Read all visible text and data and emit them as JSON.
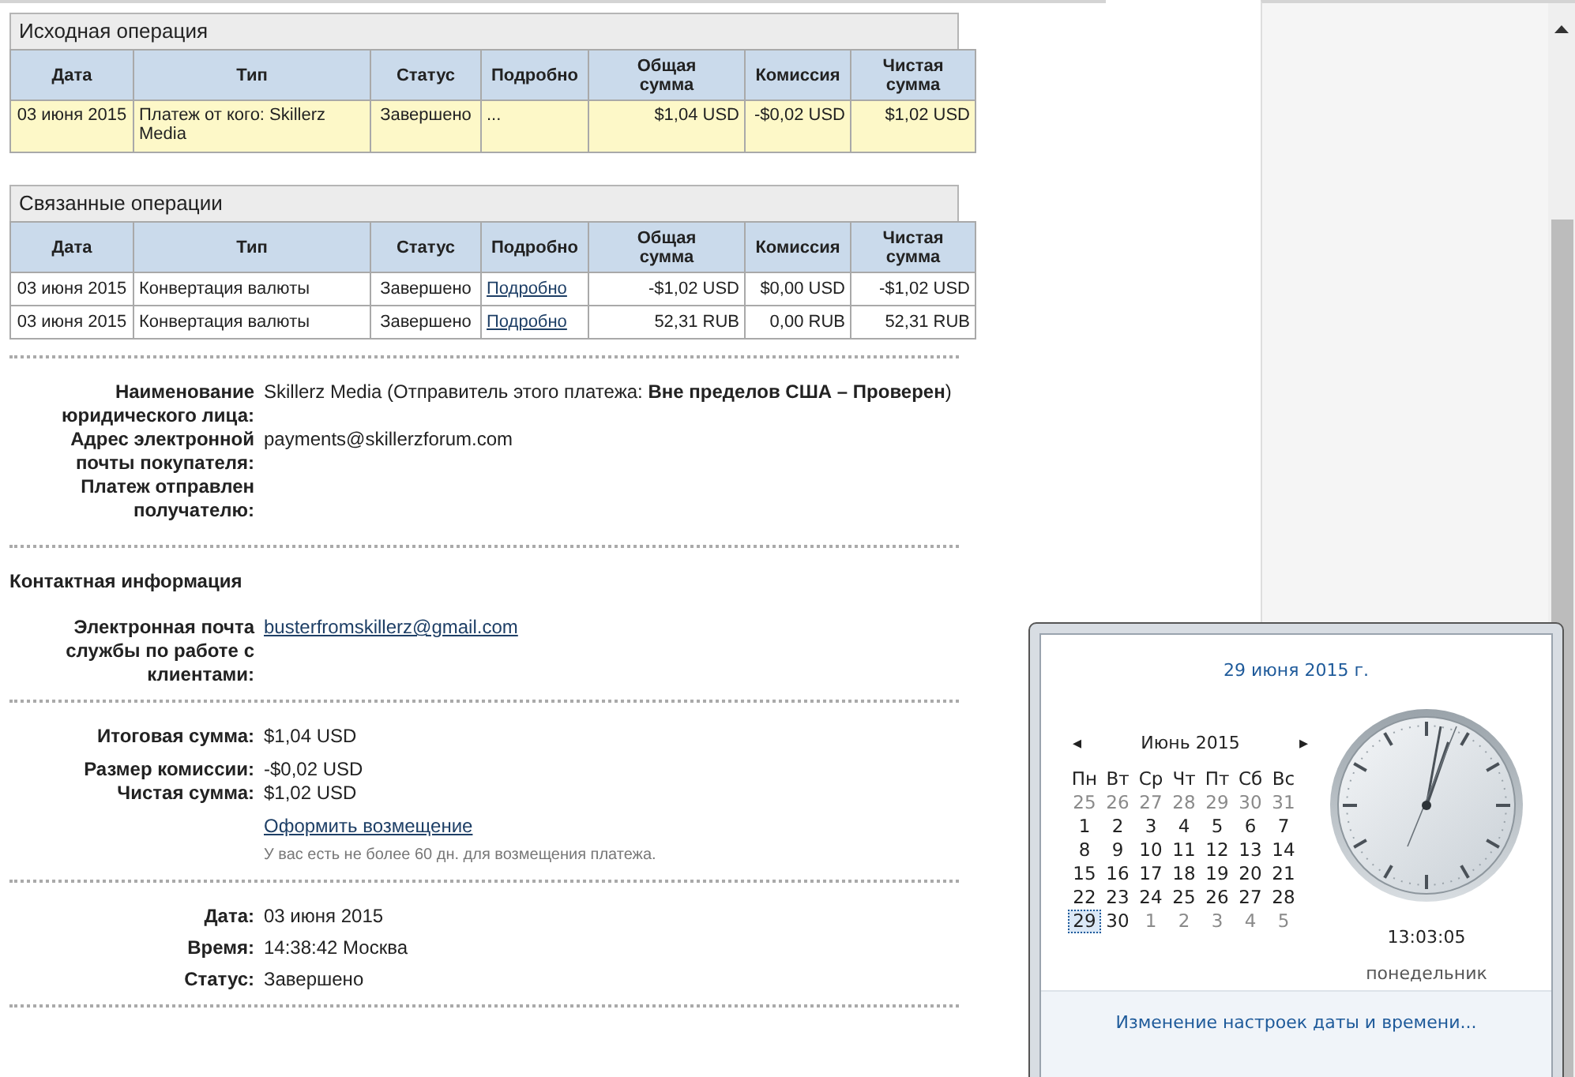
{
  "original_operation": {
    "title": "Исходная операция",
    "columns": [
      "Дата",
      "Тип",
      "Статус",
      "Подробно",
      "Общая сумма",
      "Комиссия",
      "Чистая сумма"
    ],
    "rows": [
      {
        "date": "03 июня 2015",
        "type": "Платеж от кого: Skillerz Media",
        "status": "Завершено",
        "details": {
          "kind": "text",
          "text": "..."
        },
        "gross": "$1,04 USD",
        "fee": "-$0,02 USD",
        "net": "$1,02 USD",
        "highlighted": true
      }
    ]
  },
  "related_operations": {
    "title": "Связанные операции",
    "columns": [
      "Дата",
      "Тип",
      "Статус",
      "Подробно",
      "Общая сумма",
      "Комиссия",
      "Чистая сумма"
    ],
    "rows": [
      {
        "date": "03 июня 2015",
        "type": "Конвертация валюты",
        "status": "Завершено",
        "details": {
          "kind": "link",
          "text": "Подробно"
        },
        "gross": "-$1,02 USD",
        "fee": "$0,00 USD",
        "net": "-$1,02 USD",
        "highlighted": false
      },
      {
        "date": "03 июня 2015",
        "type": "Конвертация валюты",
        "status": "Завершено",
        "details": {
          "kind": "link",
          "text": "Подробно"
        },
        "gross": "52,31 RUB",
        "fee": "0,00 RUB",
        "net": "52,31 RUB",
        "highlighted": false
      }
    ]
  },
  "payer": [
    {
      "label": "Наименование юридического лица:",
      "value": "Skillerz Media (Отправитель этого платежа: **Вне пределов США – Проверен**)"
    },
    {
      "label": "Адрес электронной почты покупателя:",
      "value": "payments@skillerzforum.com"
    },
    {
      "label": "Платеж отправлен получателю:"
    }
  ],
  "contact": {
    "title": "Контактная информация",
    "fields": [
      {
        "label": "Электронная почта службы по работе с клиентами:",
        "value": "busterfromskillerz@gmail.com",
        "kind": "link"
      }
    ]
  },
  "amounts": {
    "fields": [
      {
        "label": "Итоговая сумма:",
        "value": "$1,04 USD"
      },
      {
        "label": "Размер комиссии:",
        "value": "-$0,02 USD"
      },
      {
        "label": "Чистая сумма:",
        "value": "$1,02 USD"
      }
    ],
    "refund_link": "Оформить возмещение",
    "refund_note": "У вас есть не более 60 дн. для возмещения платежа."
  },
  "info": [
    {
      "label": "Дата:",
      "value": "03 июня 2015"
    },
    {
      "label": "Время:",
      "value": "14:38:42 Москва"
    },
    {
      "label": "Статус:",
      "value": "Завершено"
    }
  ],
  "calendar_popup": {
    "date_title": "29 июня 2015 г.",
    "prev": "◂",
    "month": "Июнь 2015",
    "next": "▸",
    "weekdays": [
      "Пн",
      "Вт",
      "Ср",
      "Чт",
      "Пт",
      "Сб",
      "Вс"
    ],
    "weeks": [
      [
        {
          "d": "25",
          "other_month": true,
          "selected": false
        },
        {
          "d": "26",
          "other_month": true,
          "selected": false
        },
        {
          "d": "27",
          "other_month": true,
          "selected": false
        },
        {
          "d": "28",
          "other_month": true,
          "selected": false
        },
        {
          "d": "29",
          "other_month": true,
          "selected": false
        },
        {
          "d": "30",
          "other_month": true,
          "selected": false
        },
        {
          "d": "31",
          "other_month": true,
          "selected": false
        }
      ],
      [
        {
          "d": "1",
          "other_month": false,
          "selected": false
        },
        {
          "d": "2",
          "other_month": false,
          "selected": false
        },
        {
          "d": "3",
          "other_month": false,
          "selected": false
        },
        {
          "d": "4",
          "other_month": false,
          "selected": false
        },
        {
          "d": "5",
          "other_month": false,
          "selected": false
        },
        {
          "d": "6",
          "other_month": false,
          "selected": false
        },
        {
          "d": "7",
          "other_month": false,
          "selected": false
        }
      ],
      [
        {
          "d": "8",
          "other_month": false,
          "selected": false
        },
        {
          "d": "9",
          "other_month": false,
          "selected": false
        },
        {
          "d": "10",
          "other_month": false,
          "selected": false
        },
        {
          "d": "11",
          "other_month": false,
          "selected": false
        },
        {
          "d": "12",
          "other_month": false,
          "selected": false
        },
        {
          "d": "13",
          "other_month": false,
          "selected": false
        },
        {
          "d": "14",
          "other_month": false,
          "selected": false
        }
      ],
      [
        {
          "d": "15",
          "other_month": false,
          "selected": false
        },
        {
          "d": "16",
          "other_month": false,
          "selected": false
        },
        {
          "d": "17",
          "other_month": false,
          "selected": false
        },
        {
          "d": "18",
          "other_month": false,
          "selected": false
        },
        {
          "d": "19",
          "other_month": false,
          "selected": false
        },
        {
          "d": "20",
          "other_month": false,
          "selected": false
        },
        {
          "d": "21",
          "other_month": false,
          "selected": false
        }
      ],
      [
        {
          "d": "22",
          "other_month": false,
          "selected": false
        },
        {
          "d": "23",
          "other_month": false,
          "selected": false
        },
        {
          "d": "24",
          "other_month": false,
          "selected": false
        },
        {
          "d": "25",
          "other_month": false,
          "selected": false
        },
        {
          "d": "26",
          "other_month": false,
          "selected": false
        },
        {
          "d": "27",
          "other_month": false,
          "selected": false
        },
        {
          "d": "28",
          "other_month": false,
          "selected": false
        }
      ],
      [
        {
          "d": "29",
          "other_month": false,
          "selected": true
        },
        {
          "d": "30",
          "other_month": false,
          "selected": false
        },
        {
          "d": "1",
          "other_month": true,
          "selected": false
        },
        {
          "d": "2",
          "other_month": true,
          "selected": false
        },
        {
          "d": "3",
          "other_month": true,
          "selected": false
        },
        {
          "d": "4",
          "other_month": true,
          "selected": false
        },
        {
          "d": "5",
          "other_month": true,
          "selected": false
        }
      ]
    ],
    "time": "13:03:05",
    "weekday": "понедельник",
    "settings_link": "Изменение настроек даты и времени..."
  }
}
